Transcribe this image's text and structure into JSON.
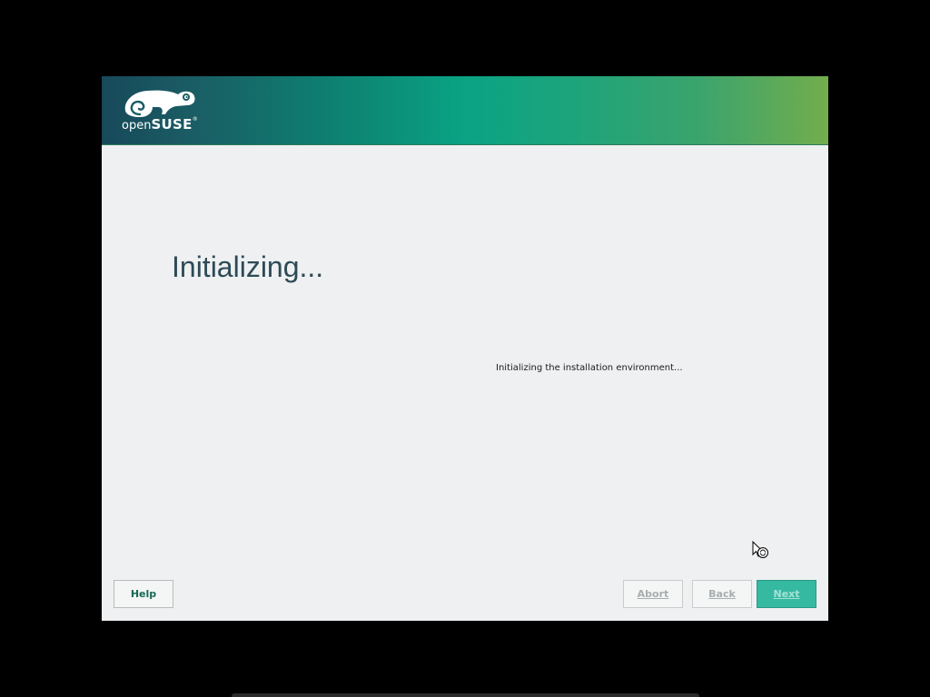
{
  "brand": {
    "logo_prefix": "open",
    "logo_name": "SUSE",
    "trademark": "®"
  },
  "page": {
    "title": "Initializing...",
    "status": "Initializing the installation environment..."
  },
  "buttons": {
    "help": "Help",
    "abort": "Abort",
    "back": "Back",
    "next": "Next",
    "abort_enabled": false,
    "back_enabled": false,
    "next_enabled": false
  },
  "icons": {
    "logo": "opensuse-chameleon-logo",
    "cursor": "busy-pointer-icon"
  },
  "colors": {
    "accent": "#35b9a1",
    "banner_start": "#17495a",
    "banner_end": "#73ad4d",
    "title": "#2d4a56",
    "help_text": "#156a55"
  }
}
